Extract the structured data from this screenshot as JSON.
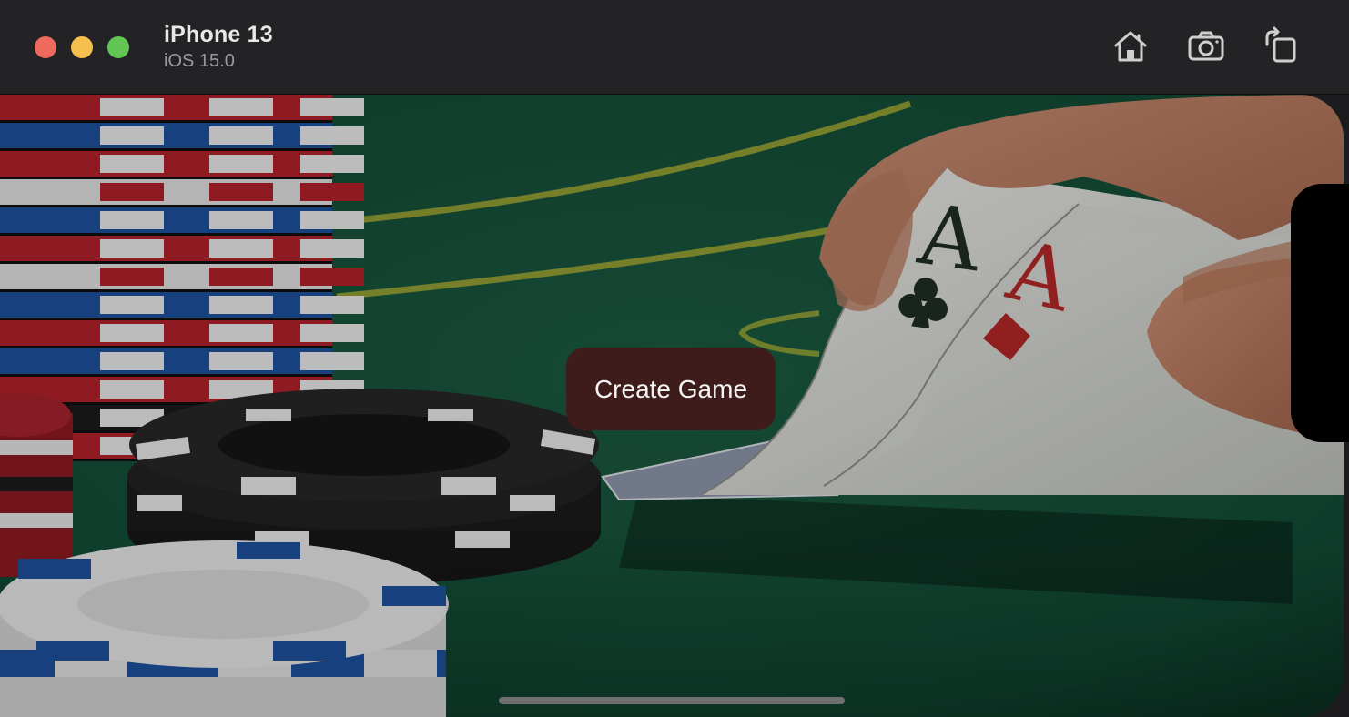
{
  "titlebar": {
    "device_name": "iPhone 13",
    "os_version": "iOS 15.0",
    "buttons": [
      {
        "name": "home",
        "icon": "house-icon"
      },
      {
        "name": "screenshot",
        "icon": "camera-icon"
      },
      {
        "name": "rotate",
        "icon": "rotate-icon"
      }
    ]
  },
  "app": {
    "create_game_label": "Create Game",
    "background": "poker-table-image"
  },
  "colors": {
    "titlebar_bg": "#232325",
    "felt": "#124a35",
    "button_bg": "#3e1c1c",
    "button_text": "#f4f4f4",
    "chip_red": "#b0202a",
    "chip_blue": "#1c4f9a",
    "chip_black": "#1c1c1c"
  }
}
